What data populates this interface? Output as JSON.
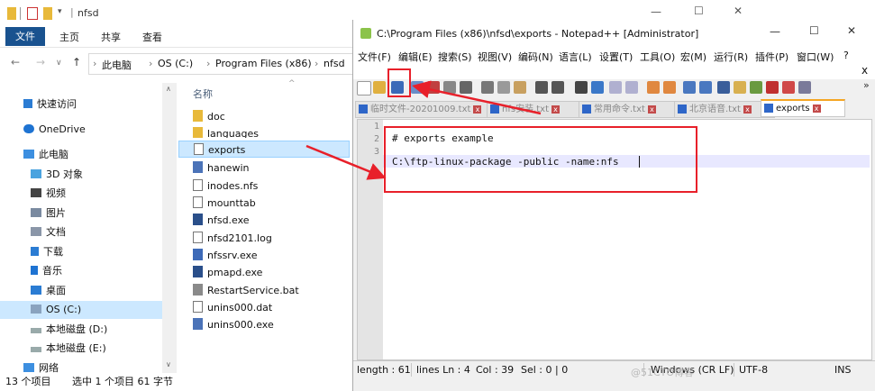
{
  "explorer": {
    "title": "nfsd",
    "tabs": [
      "文件",
      "主页",
      "共享",
      "查看"
    ],
    "breadcrumb": [
      "此电脑",
      "OS (C:)",
      "Program Files (x86)",
      "nfsd"
    ],
    "column_header": "名称",
    "sidebar": {
      "quick_access": "快速访问",
      "onedrive": "OneDrive",
      "this_pc": "此电脑",
      "items": [
        "3D 对象",
        "视频",
        "图片",
        "文档",
        "下载",
        "音乐",
        "桌面",
        "OS (C:)",
        "本地磁盘 (D:)",
        "本地磁盘 (E:)",
        "网络"
      ]
    },
    "files": [
      "doc",
      "languages",
      "exports",
      "hanewin",
      "inodes.nfs",
      "mounttab",
      "nfsd.exe",
      "nfsd2101.log",
      "nfssrv.exe",
      "pmapd.exe",
      "RestartService.bat",
      "unins000.dat",
      "unins000.exe"
    ],
    "status": {
      "count": "13 个项目",
      "selection": "选中 1 个项目 61 字节"
    }
  },
  "npp": {
    "title": "C:\\Program Files (x86)\\nfsd\\exports - Notepad++ [Administrator]",
    "menu": [
      "文件(F)",
      "编辑(E)",
      "搜索(S)",
      "视图(V)",
      "编码(N)",
      "语言(L)",
      "设置(T)",
      "工具(O)",
      "宏(M)",
      "运行(R)",
      "插件(P)",
      "窗口(W)",
      "?"
    ],
    "tabs": [
      "临时文件-20201009.txt",
      "nfs安装.txt",
      "常用命令.txt",
      "北京语音.txt",
      "exports"
    ],
    "lines": [
      "",
      "# exports example",
      "C:\\ftp-linux-package -public -name:nfs"
    ],
    "line_numbers": [
      "1",
      "2",
      "3"
    ],
    "status": {
      "length": "length : 61",
      "lines": "lines Ln : 4",
      "col": "Col : 39",
      "sel": "Sel : 0 | 0",
      "eol": "Windows (CR LF)",
      "enc": "UTF-8",
      "ins": "INS"
    }
  },
  "window_controls": {
    "minimize": "—",
    "maximize": "☐",
    "close": "✕"
  },
  "watermark": "@51CTO博客",
  "colors": {
    "accent": "#19528f",
    "selection": "#cce8ff",
    "annotation": "#e8202a"
  }
}
